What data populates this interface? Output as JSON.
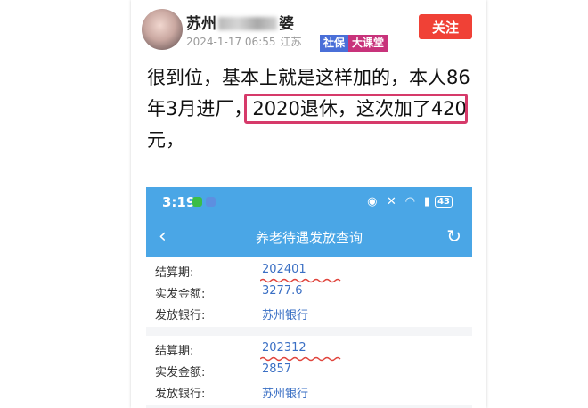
{
  "post": {
    "username_prefix": "苏州",
    "username_suffix": "婆",
    "date": "2024-1-17 06:55",
    "location": "江苏",
    "follow_label": "关注",
    "tags": [
      "社保",
      "大课堂"
    ],
    "text_line1": "很到位，基本上就是这样加的，本人86",
    "text_line2_a": "年3月进厂，",
    "text_line2_b": "2020退休，这次加了420",
    "text_line3": "元，"
  },
  "phone": {
    "time": "3:19",
    "status_icons": "◉ ✕ ◠ ▮",
    "battery": "43",
    "nav_title": "养老待遇发放查询",
    "back_icon": "‹",
    "refresh_icon": "↻",
    "records": [
      {
        "period_label": "结算期:",
        "period": "202401",
        "amount_label": "实发金额:",
        "amount": "3277.6",
        "bank_label": "发放银行:",
        "bank": "苏州银行"
      },
      {
        "period_label": "结算期:",
        "period": "202312",
        "amount_label": "实发金额:",
        "amount": "2857",
        "bank_label": "发放银行:",
        "bank": "苏州银行"
      }
    ]
  },
  "colors": {
    "accent_red": "#f04136",
    "phone_blue": "#4aa6e6",
    "highlight_box": "#d63a6a",
    "squiggle": "#e0443c"
  }
}
